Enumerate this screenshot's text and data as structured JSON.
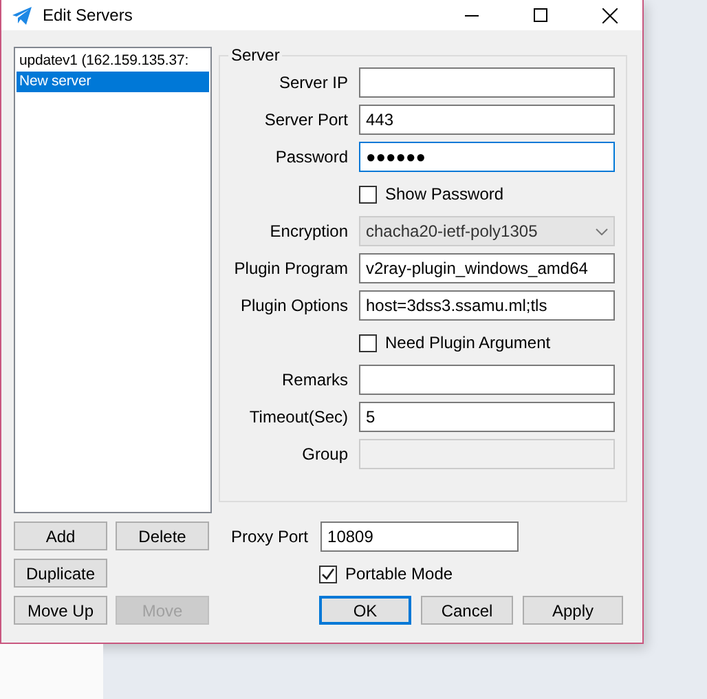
{
  "window": {
    "title": "Edit Servers"
  },
  "server_list": [
    {
      "label": "updatev1 (162.159.135.37:",
      "selected": false
    },
    {
      "label": "New server",
      "selected": true
    }
  ],
  "server_group": {
    "title": "Server",
    "rows": [
      {
        "kind": "field",
        "label": "Server IP",
        "disabled": false,
        "focused": false
      },
      {
        "kind": "field",
        "label": "Server Port",
        "value": "443",
        "disabled": false,
        "focused": false
      },
      {
        "kind": "field",
        "label": "Password",
        "value": "●●●●●●",
        "disabled": false,
        "focused": true
      },
      {
        "kind": "checkbox",
        "label": "Show Password",
        "checked": false
      },
      {
        "kind": "dropdown",
        "label": "Encryption",
        "value": "chacha20-ietf-poly1305",
        "disabled": true
      },
      {
        "kind": "field",
        "label": "Plugin Program",
        "value": "v2ray-plugin_windows_amd64",
        "disabled": false,
        "focused": false
      },
      {
        "kind": "field",
        "label": "Plugin Options",
        "value": "host=3dss3.ssamu.ml;tls",
        "disabled": false,
        "focused": false
      },
      {
        "kind": "checkbox",
        "label": "Need Plugin Argument",
        "checked": false
      },
      {
        "kind": "field",
        "label": "Remarks",
        "disabled": false,
        "focused": false
      },
      {
        "kind": "field",
        "label": "Timeout(Sec)",
        "value": "5",
        "disabled": false,
        "focused": false
      },
      {
        "kind": "field",
        "label": "Group",
        "disabled": true,
        "focused": false
      }
    ]
  },
  "list_buttons": [
    {
      "label": "Add",
      "disabled": false
    },
    {
      "label": "Delete",
      "disabled": false
    },
    {
      "label": "Duplicate",
      "disabled": false
    },
    {
      "label": "Move Up",
      "disabled": false
    },
    {
      "label": "Move",
      "disabled": true
    }
  ],
  "proxy_port": {
    "label": "Proxy Port",
    "value": "10809"
  },
  "portable_mode": {
    "label": "Portable Mode",
    "checked": true
  },
  "dialog_buttons": [
    {
      "label": "OK",
      "default": true
    },
    {
      "label": "Cancel",
      "default": false
    },
    {
      "label": "Apply",
      "default": false
    }
  ]
}
